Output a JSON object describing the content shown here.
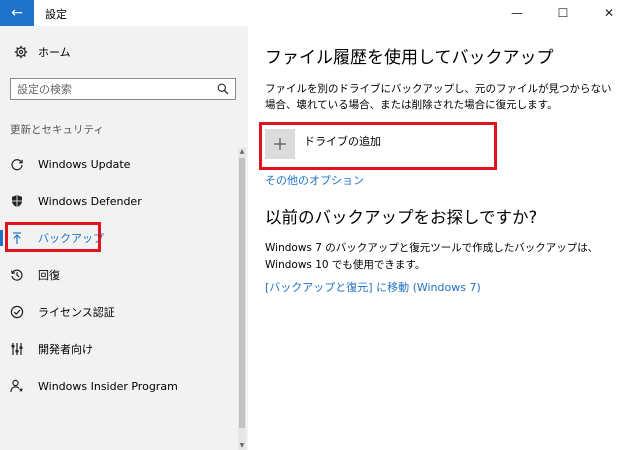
{
  "window": {
    "title": "設定",
    "controls": {
      "minimize": "—",
      "maximize": "☐",
      "close": "✕"
    }
  },
  "sidebar": {
    "home_label": "ホーム",
    "search": {
      "placeholder": "設定の検索"
    },
    "section_label": "更新とセキュリティ",
    "items": [
      {
        "label": "Windows Update",
        "icon": "refresh-icon"
      },
      {
        "label": "Windows Defender",
        "icon": "shield-icon"
      },
      {
        "label": "バックアップ",
        "icon": "backup-arrow-icon",
        "active": true
      },
      {
        "label": "回復",
        "icon": "history-icon"
      },
      {
        "label": "ライセンス認証",
        "icon": "check-circle-icon"
      },
      {
        "label": "開発者向け",
        "icon": "developer-sliders-icon"
      },
      {
        "label": "Windows Insider Program",
        "icon": "insider-person-icon"
      }
    ]
  },
  "main": {
    "title": "ファイル履歴を使用してバックアップ",
    "description": "ファイルを別のドライブにバックアップし、元のファイルが見つからない場合、壊れている場合、または削除された場合に復元します。",
    "add_drive_label": "ドライブの追加",
    "more_options_link": "その他のオプション",
    "older_title": "以前のバックアップをお探しですか?",
    "older_description": "Windows 7 のバックアップと復元ツールで作成したバックアップは、Windows 10 でも使用できます。",
    "older_link": "[バックアップと復元] に移動 (Windows 7)"
  },
  "colors": {
    "accent": "#1f73c8",
    "highlight": "#e0141e",
    "sidebar_bg": "#f2f2f2"
  }
}
